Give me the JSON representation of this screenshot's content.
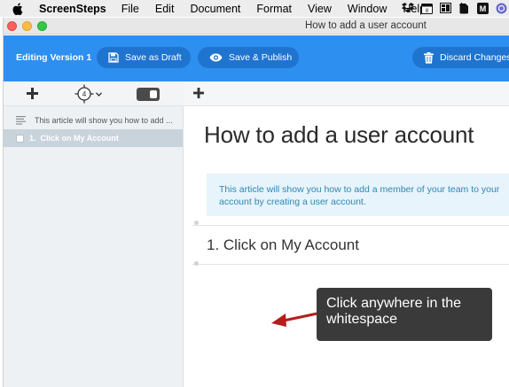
{
  "menubar": {
    "app_name": "ScreenSteps",
    "items": [
      "File",
      "Edit",
      "Document",
      "Format",
      "View",
      "Window",
      "Help"
    ]
  },
  "window": {
    "title": "How to add a user account"
  },
  "toolbar": {
    "editing_label": "Editing Version 1",
    "save_draft_label": "Save as Draft",
    "save_publish_label": "Save & Publish",
    "discard_label": "Discard Changes",
    "accent_color": "#2d8ff0"
  },
  "sidebar": {
    "step_number": "4",
    "items": [
      {
        "label": "This article will show you how to add ...",
        "icon": "text-lines-icon"
      },
      {
        "number": "1.",
        "label": "Click on My Account",
        "selected": true
      }
    ]
  },
  "main": {
    "title": "How to add a user account",
    "intro_text": "This article will show you how to add a member of your team to your account by creating a user account.",
    "step_heading": "1. Click on My Account"
  },
  "annotation": {
    "text": "Click anywhere in the whitespace",
    "arrow_color": "#b71c1c"
  }
}
